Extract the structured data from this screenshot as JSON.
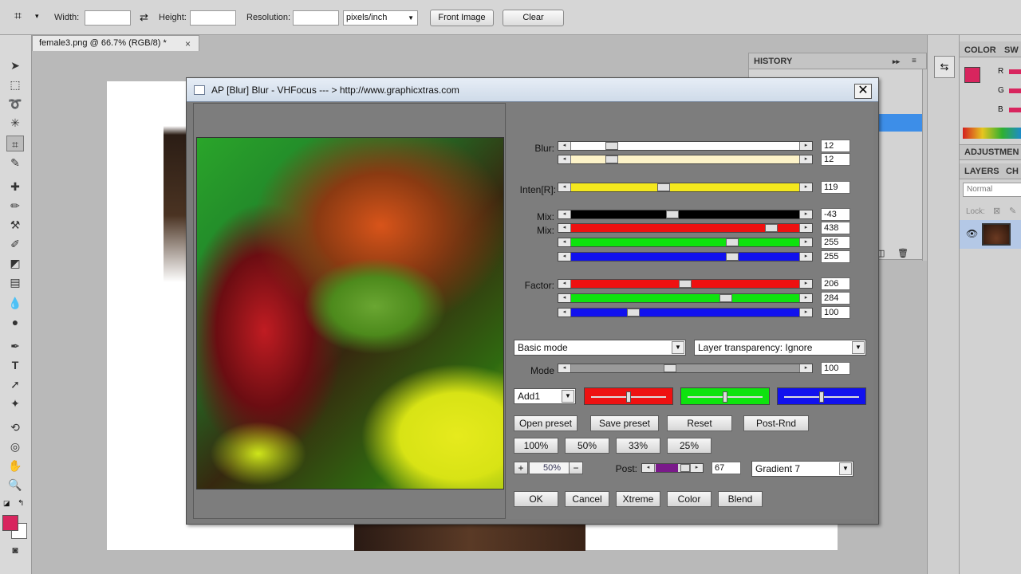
{
  "options_bar": {
    "width_label": "Width:",
    "height_label": "Height:",
    "resolution_label": "Resolution:",
    "resolution_unit": "pixels/inch",
    "front_image_button": "Front Image",
    "clear_button": "Clear"
  },
  "document": {
    "tab_title": "female3.png @ 66.7% (RGB/8) *",
    "close_glyph": "×"
  },
  "panels": {
    "history_title": "HISTORY",
    "color_tab": "COLOR",
    "swatches_tab": "SW",
    "rgb": [
      "R",
      "G",
      "B"
    ],
    "adjustments_tab": "ADJUSTMEN",
    "layers_tab": "LAYERS",
    "channels_tab": "CH",
    "blend_mode": "Normal",
    "lock_label": "Lock:",
    "foreground_color": "#d8255e"
  },
  "dialog": {
    "title": "AP [Blur]  Blur - VHFocus    --- > http://www.graphicxtras.com",
    "close_glyph": "✕",
    "labels": {
      "blur": "Blur:",
      "inten": "Inten[R]:",
      "mix1": "Mix:",
      "mix2": "Mix:",
      "factor": "Factor:",
      "mode": "Mode",
      "post": "Post:"
    },
    "sliders": [
      {
        "id": "blur1",
        "value": "12",
        "track": "#ffffff",
        "pos": 0.16
      },
      {
        "id": "blur2",
        "value": "12",
        "track": "#fdf3c8",
        "pos": 0.16
      },
      {
        "id": "inten",
        "value": "119",
        "track": "#f4e81e",
        "pos": 0.4
      },
      {
        "id": "mix_black",
        "value": "-43",
        "track": "#000000",
        "pos": 0.44
      },
      {
        "id": "mix_red",
        "value": "438",
        "track": "#ee1111",
        "pos": 0.9
      },
      {
        "id": "mix_green",
        "value": "255",
        "track": "#0ee30e",
        "pos": 0.72
      },
      {
        "id": "mix_blue",
        "value": "255",
        "track": "#1111ee",
        "pos": 0.72
      },
      {
        "id": "factor_red",
        "value": "206",
        "track": "#ee1111",
        "pos": 0.5
      },
      {
        "id": "factor_green",
        "value": "284",
        "track": "#0ee30e",
        "pos": 0.69
      },
      {
        "id": "factor_blue",
        "value": "100",
        "track": "#1111ee",
        "pos": 0.26
      },
      {
        "id": "mode",
        "value": "100",
        "track": "#9a9a9a",
        "pos": 0.43
      }
    ],
    "basic_mode": "Basic mode",
    "layer_transparency": "Layer transparency: Ignore",
    "add_mode": "Add1",
    "color_sliders": [
      {
        "color": "#ee1111",
        "pos": 0.5
      },
      {
        "color": "#0ee30e",
        "pos": 0.5
      },
      {
        "color": "#1111ee",
        "pos": 0.5
      }
    ],
    "buttons_row1": [
      "Open preset",
      "Save preset",
      "Reset",
      "Post-Rnd"
    ],
    "zoom_buttons": [
      "100%",
      "50%",
      "33%",
      "25%"
    ],
    "zoom_plus": "+",
    "zoom_value": "50%",
    "zoom_minus": "−",
    "post_value": "67",
    "gradient": "Gradient 7",
    "bottom_buttons": [
      "OK",
      "Cancel",
      "Xtreme",
      "Color",
      "Blend"
    ]
  }
}
